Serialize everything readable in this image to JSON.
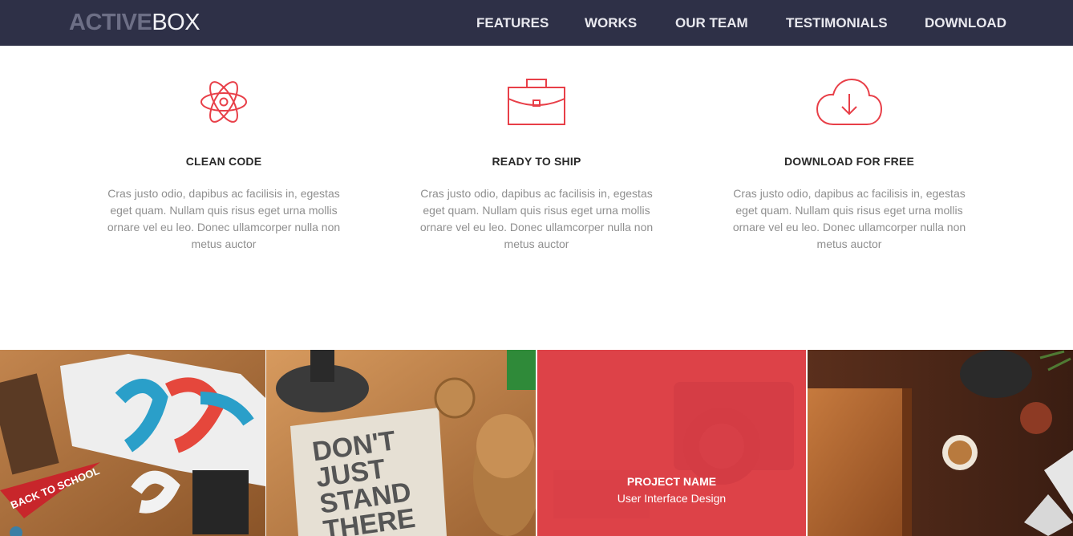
{
  "header": {
    "logo_bold": "ACTIVE",
    "logo_light": "BOX",
    "nav": [
      {
        "label": "FEATURES"
      },
      {
        "label": "WORKS"
      },
      {
        "label": "OUR TEAM"
      },
      {
        "label": "TESTIMONIALS"
      },
      {
        "label": "DOWNLOAD"
      }
    ]
  },
  "features": [
    {
      "icon": "atom-icon",
      "title": "CLEAN CODE",
      "text": "Cras justo odio, dapibus ac facilisis in, egestas eget quam. Nullam quis risus eget urna mollis ornare vel eu leo. Donec ullamcorper nulla non metus auctor"
    },
    {
      "icon": "briefcase-icon",
      "title": "READY TO SHIP",
      "text": "Cras justo odio, dapibus ac facilisis in, egestas eget quam. Nullam quis risus eget urna mollis ornare vel eu leo. Donec ullamcorper nulla non metus auctor"
    },
    {
      "icon": "cloud-download-icon",
      "title": "DOWNLOAD FOR FREE",
      "text": "Cras justo odio, dapibus ac facilisis in, egestas eget quam. Nullam quis risus eget urna mollis ornare vel eu leo. Donec ullamcorper nulla non metus auctor"
    }
  ],
  "portfolio": {
    "hover_item": {
      "name": "PROJECT NAME",
      "category": "User Interface Design"
    },
    "photo_text": {
      "pennant": "BACK TO SCHOOL",
      "poster": [
        "DON'T",
        "JUST",
        "STAND",
        "THERE"
      ]
    }
  },
  "colors": {
    "nav_bg": "#2e3047",
    "accent": "#e83f48",
    "body_text": "#8f8f8f",
    "heading_text": "#2a2a2a"
  }
}
